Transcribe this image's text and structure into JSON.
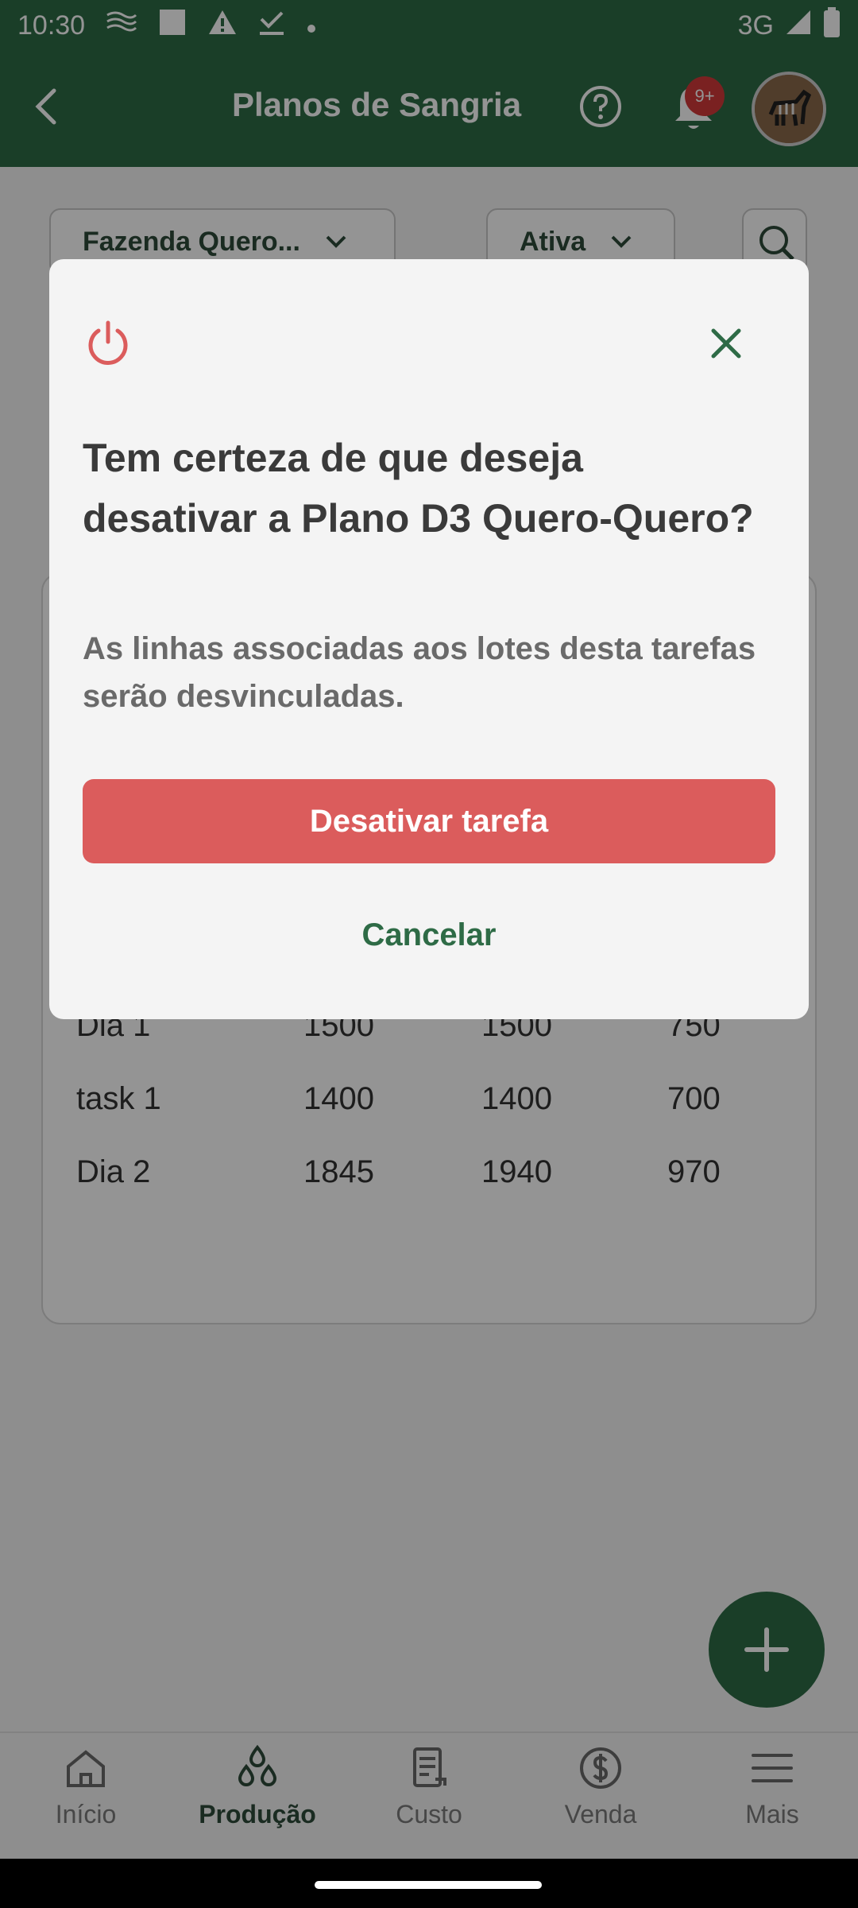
{
  "status_bar": {
    "time": "10:30",
    "network": "3G",
    "icons": [
      "signal-waves-icon",
      "square-icon",
      "warning-icon",
      "download-done-icon",
      "dot-icon",
      "cell-signal-icon",
      "battery-icon"
    ]
  },
  "app_bar": {
    "title": "Planos de Sangria",
    "notification_badge": "9+",
    "colors": {
      "primary": "#2e6b46",
      "badge": "#d23a3a"
    }
  },
  "filters": {
    "farm_label": "Fazenda Quero...",
    "status_label": "Ativa"
  },
  "table": {
    "rows": [
      [
        "Dia 1",
        "1500",
        "1500",
        "750"
      ],
      [
        "task 1",
        "1400",
        "1400",
        "700"
      ],
      [
        "Dia 2",
        "1845",
        "1940",
        "970"
      ]
    ]
  },
  "bottom_nav": {
    "items": [
      {
        "label": "Início",
        "icon": "home-icon"
      },
      {
        "label": "Produção",
        "icon": "drops-icon",
        "active": true
      },
      {
        "label": "Custo",
        "icon": "receipt-icon"
      },
      {
        "label": "Venda",
        "icon": "dollar-icon"
      },
      {
        "label": "Mais",
        "icon": "menu-icon"
      }
    ]
  },
  "dialog": {
    "title": "Tem certeza de que deseja desativar a Plano D3 Quero-Quero?",
    "message": "As linhas associadas aos lotes desta tarefas serão desvinculadas.",
    "confirm_label": "Desativar tarefa",
    "cancel_label": "Cancelar",
    "colors": {
      "danger": "#db5c5c",
      "accent": "#2e6b46"
    }
  }
}
